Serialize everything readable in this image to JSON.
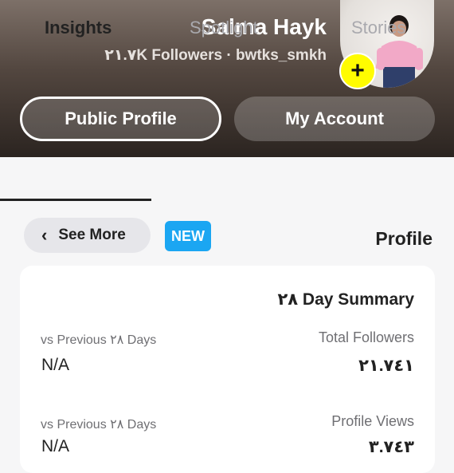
{
  "header": {
    "name": "Salma Hayk",
    "subtitle": "٢١.٧K Followers · bwtks_smkh",
    "public_profile_label": "Public Profile",
    "my_account_label": "My Account",
    "add_icon": "plus-icon",
    "colors": {
      "add_badge": "#fffc00",
      "header_dark": "#2b2420"
    }
  },
  "tabs": [
    {
      "label": "Insights",
      "active": true
    },
    {
      "label": "Spotlight",
      "active": false
    },
    {
      "label": "Stories",
      "active": false
    }
  ],
  "toolbar": {
    "see_more_label": "See More",
    "see_more_icon": "chevron-left-icon",
    "new_badge": "NEW",
    "section_title": "Profile",
    "colors": {
      "new_badge": "#1ba6f2"
    }
  },
  "summary": {
    "title": "٢٨ Day Summary",
    "metrics": [
      {
        "label": "Total Followers",
        "value": "٢١.٧٤١",
        "compare_label": "vs Previous ٢٨ Days",
        "compare_value": "N/A"
      },
      {
        "label": "Profile Views",
        "value": "٣.٧٤٣",
        "compare_label": "vs Previous ٢٨ Days",
        "compare_value": "N/A"
      }
    ]
  }
}
